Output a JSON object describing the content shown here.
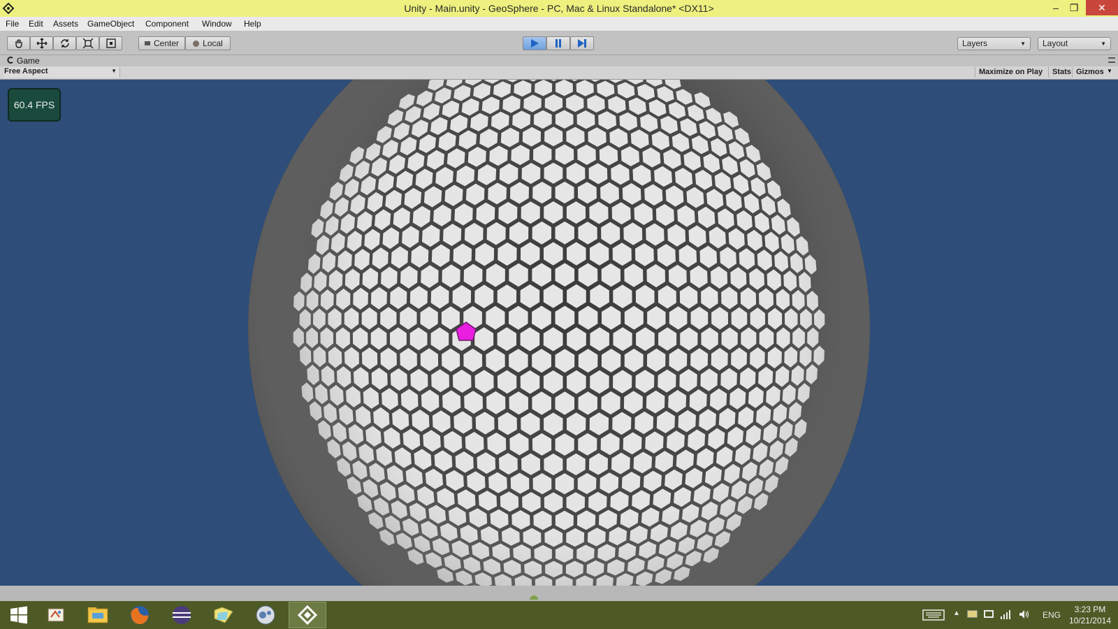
{
  "window": {
    "title": "Unity - Main.unity - GeoSphere - PC, Mac & Linux Standalone* <DX11>",
    "minimize": "–",
    "restore": "❐",
    "close": "✕"
  },
  "menu": [
    "File",
    "Edit",
    "Assets",
    "GameObject",
    "Component",
    "Window",
    "Help"
  ],
  "toolbar": {
    "pivot_label": "Center",
    "space_label": "Local",
    "layers_label": "Layers",
    "layout_label": "Layout"
  },
  "game_tab": {
    "label": "Game",
    "aspect": "Free Aspect",
    "maximize_on_play": "Maximize on Play",
    "stats": "Stats",
    "gizmos": "Gizmos"
  },
  "viewport": {
    "fps": "60.4 FPS",
    "background_color": "#2e4d78",
    "sphere_face_color": "#e6e6e6",
    "highlight_color": "#e81ee0"
  },
  "taskbar": {
    "language": "ENG",
    "time": "3:23 PM",
    "date": "10/21/2014",
    "apps": [
      "start-icon",
      "paint-icon",
      "file-explorer-icon",
      "firefox-icon",
      "eclipse-icon",
      "folder-icon",
      "monodevelop-icon",
      "unity-icon"
    ]
  }
}
